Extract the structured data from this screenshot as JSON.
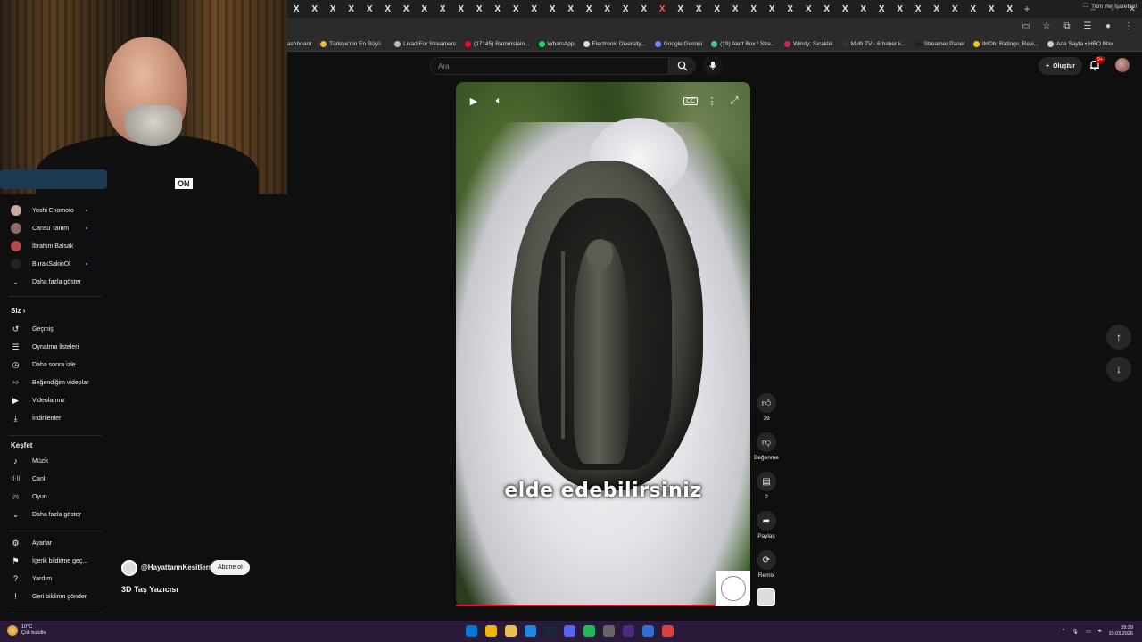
{
  "browser": {
    "tab_glyph": "X",
    "tab_count": 40,
    "active_tab_index": 20,
    "new_tab": "+",
    "bookmarks": [
      {
        "label": "ashboard",
        "color": ""
      },
      {
        "label": "Türkiye'nin En Büyü...",
        "color": "#f2b630"
      },
      {
        "label": "Livad For Streamers",
        "color": "#bbbbbb"
      },
      {
        "label": "(17145) Rammstein...",
        "color": "#ff0033"
      },
      {
        "label": "WhatsApp",
        "color": "#25d366"
      },
      {
        "label": "Electronic Diversity...",
        "color": "#dddddd"
      },
      {
        "label": "Google Gemini",
        "color": "#6d8bff"
      },
      {
        "label": "(19) Alert Box / Stre...",
        "color": "#41c9a0"
      },
      {
        "label": "Windy: Sıcaklık",
        "color": "#d6224f"
      },
      {
        "label": "Multi TV - 6 haber k...",
        "color": "#333333"
      },
      {
        "label": "Streamer Panel",
        "color": "#222222"
      },
      {
        "label": "IMDb: Ratings, Revi...",
        "color": "#f5c518"
      },
      {
        "label": "Ana Sayfa • HBO Max",
        "color": "#cccccc"
      }
    ],
    "bookmarks_folder": "Tüm Yer İşaretleri"
  },
  "header": {
    "search_placeholder": "Ara",
    "create_label": "Oluştur",
    "notification_count": "9+"
  },
  "sidebar": {
    "subscriptions": [
      {
        "name": "Yoshi Enomoto",
        "avatar_color": "#c9a9a0",
        "new": true
      },
      {
        "name": "Cansu Tanım",
        "avatar_color": "#8d6b5f",
        "new": true
      },
      {
        "name": "İbrahim Balsak",
        "avatar_color": "#b04a4a",
        "new": false
      },
      {
        "name": "BurakSakinOl",
        "avatar_color": "#222222",
        "new": true
      }
    ],
    "show_more_1": "Daha fazla göster",
    "you_heading": "Siz",
    "you_items": [
      {
        "label": "Geçmiş",
        "icon": "history-icon",
        "glyph": "↺"
      },
      {
        "label": "Oynatma listeleri",
        "icon": "playlist-icon",
        "glyph": "☰"
      },
      {
        "label": "Daha sonra izle",
        "icon": "clock-icon",
        "glyph": "◷"
      },
      {
        "label": "Beğendiğim videolar",
        "icon": "thumbs-up-icon",
        "glyph": "👍︎"
      },
      {
        "label": "Videolarınız",
        "icon": "video-icon",
        "glyph": "▶"
      },
      {
        "label": "İndirilenler",
        "icon": "download-icon",
        "glyph": "⤓"
      }
    ],
    "explore_heading": "Keşfet",
    "explore_items": [
      {
        "label": "Müzik",
        "icon": "music-icon",
        "glyph": "♪"
      },
      {
        "label": "Canlı",
        "icon": "live-icon",
        "glyph": "((·))"
      },
      {
        "label": "Oyun",
        "icon": "gamepad-icon",
        "glyph": "🎮︎"
      }
    ],
    "show_more_2": "Daha fazla göster",
    "bottom_items": [
      {
        "label": "Ayarlar",
        "icon": "gear-icon",
        "glyph": "⚙"
      },
      {
        "label": "İçerik bildirme geç...",
        "icon": "flag-icon",
        "glyph": "⚑"
      },
      {
        "label": "Yardım",
        "icon": "help-icon",
        "glyph": "?"
      },
      {
        "label": "Geri bildirim gönder",
        "icon": "feedback-icon",
        "glyph": "!"
      }
    ]
  },
  "short": {
    "subtitle": "elde edebilirsiniz",
    "channel_handle": "@HayattannKesitlerr",
    "subscribe_label": "Abone ol",
    "title": "3D Taş Yazıcısı",
    "progress_fraction": 0.88,
    "actions": {
      "like_count": "39",
      "dislike_label": "Beğenme",
      "comment_count": "2",
      "share_label": "Paylaş",
      "remix_label": "Remix"
    }
  },
  "webcam": {
    "logo_text": "ON"
  },
  "taskbar": {
    "temp": "10°C",
    "weather": "Çok bulutlu",
    "time": "09:29",
    "date": "10.03.2026",
    "apps": [
      "#0078d4",
      "#f4b400",
      "#e8c04a",
      "#1e88e5",
      "#1b2838",
      "#5865f2",
      "#1db954",
      "#666666",
      "#4b2a8a",
      "#2f6fd6",
      "#d94040"
    ]
  }
}
